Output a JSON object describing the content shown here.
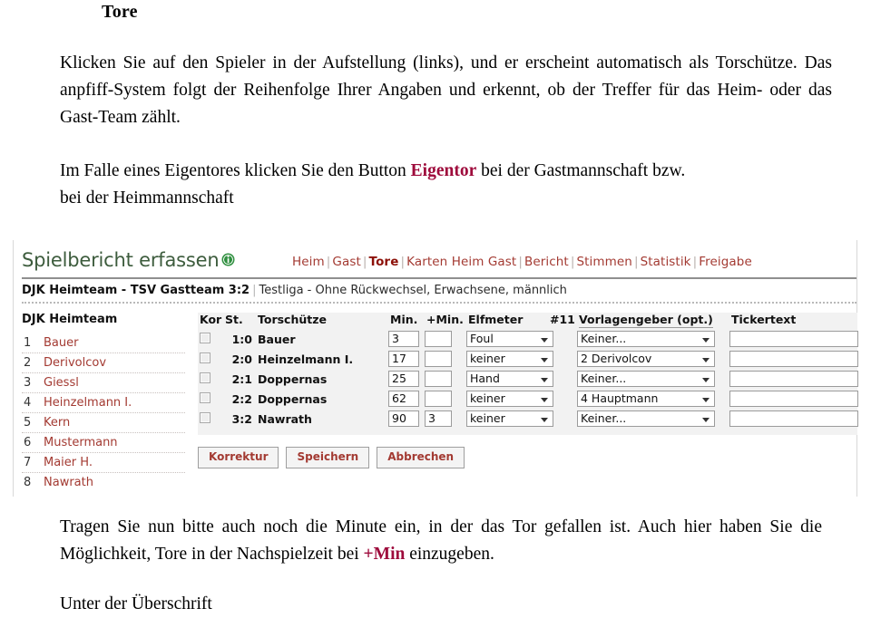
{
  "document": {
    "heading": "Tore",
    "paragraph_1_part1": "Klicken Sie auf den Spieler in der Aufstellung (links), und er erscheint automatisch als Torschütze. Das anpfiff-System folgt der Reihenfolge Ihrer Angaben und erkennt, ob der Treffer für das Heim- oder das Gast-Team zählt.",
    "paragraph_2_before": "Im Falle eines Eigentores klicken Sie den Button ",
    "paragraph_2_highlight": "Eigentor",
    "paragraph_2_after": " bei der Gastmannschaft bzw. bei der Heimmannschaft",
    "paragraph_3_before": "Tragen Sie nun bitte auch noch die Minute ein, in der das Tor gefallen ist. Auch hier haben Sie die Möglichkeit, Tore in der Nachspielzeit bei ",
    "paragraph_3_highlight": "+Min",
    "paragraph_3_after": " einzugeben.",
    "paragraph_4": "Unter der Überschrift",
    "highlight_color": "#9e0b3c"
  },
  "app": {
    "title": "Spielbericht erfassen",
    "info_icon": "info-circle-icon",
    "title_color": "#3d5c3d",
    "link_color": "#a33a32",
    "active_tab_color": "#8c1008",
    "nav": [
      {
        "label": "Heim",
        "active": false
      },
      {
        "label": "Gast",
        "active": false
      },
      {
        "label": "Tore",
        "active": true
      },
      {
        "label": "Karten Heim Gast",
        "active": false
      },
      {
        "label": "Bericht",
        "active": false
      },
      {
        "label": "Stimmen",
        "active": false
      },
      {
        "label": "Statistik",
        "active": false
      },
      {
        "label": "Freigabe",
        "active": false
      }
    ],
    "nav_separator": "|",
    "match": {
      "teams_score": "DJK Heimteam - TSV Gastteam 3:2",
      "separator": "|",
      "details": "Testliga - Ohne Rückwechsel, Erwachsene, männlich"
    },
    "roster": {
      "team_name": "DJK Heimteam",
      "players": [
        {
          "number": "1",
          "name": "Bauer"
        },
        {
          "number": "2",
          "name": "Derivolcov"
        },
        {
          "number": "3",
          "name": "Giessl"
        },
        {
          "number": "4",
          "name": "Heinzelmann I."
        },
        {
          "number": "5",
          "name": "Kern"
        },
        {
          "number": "6",
          "name": "Mustermann"
        },
        {
          "number": "7",
          "name": "Maier H."
        },
        {
          "number": "8",
          "name": "Nawrath"
        }
      ]
    },
    "goals_table": {
      "headers": {
        "kor": "Kor",
        "st": "St.",
        "scorer": "Torschütze",
        "min": "Min.",
        "plus_min": "+Min.",
        "penalty": "Elfmeter",
        "number": "#11",
        "assist": "Vorlagengeber (opt.)",
        "ticker": "Tickertext"
      },
      "rows": [
        {
          "kor_checked": false,
          "score": "1:0",
          "scorer": "Bauer",
          "min": "3",
          "plus_min": "",
          "penalty": "Foul",
          "assist": "Keiner...",
          "ticker": ""
        },
        {
          "kor_checked": false,
          "score": "2:0",
          "scorer": "Heinzelmann I.",
          "min": "17",
          "plus_min": "",
          "penalty": "keiner",
          "assist": "2 Derivolcov",
          "ticker": ""
        },
        {
          "kor_checked": false,
          "score": "2:1",
          "scorer": "Doppernas",
          "min": "25",
          "plus_min": "",
          "penalty": "Hand",
          "assist": "Keiner...",
          "ticker": ""
        },
        {
          "kor_checked": false,
          "score": "2:2",
          "scorer": "Doppernas",
          "min": "62",
          "plus_min": "",
          "penalty": "keiner",
          "assist": "4 Hauptmann",
          "ticker": ""
        },
        {
          "kor_checked": false,
          "score": "3:2",
          "scorer": "Nawrath",
          "min": "90",
          "plus_min": "3",
          "penalty": "keiner",
          "assist": "Keiner...",
          "ticker": ""
        }
      ]
    },
    "buttons": [
      {
        "label": "Korrektur"
      },
      {
        "label": "Speichern"
      },
      {
        "label": "Abbrechen"
      }
    ]
  }
}
